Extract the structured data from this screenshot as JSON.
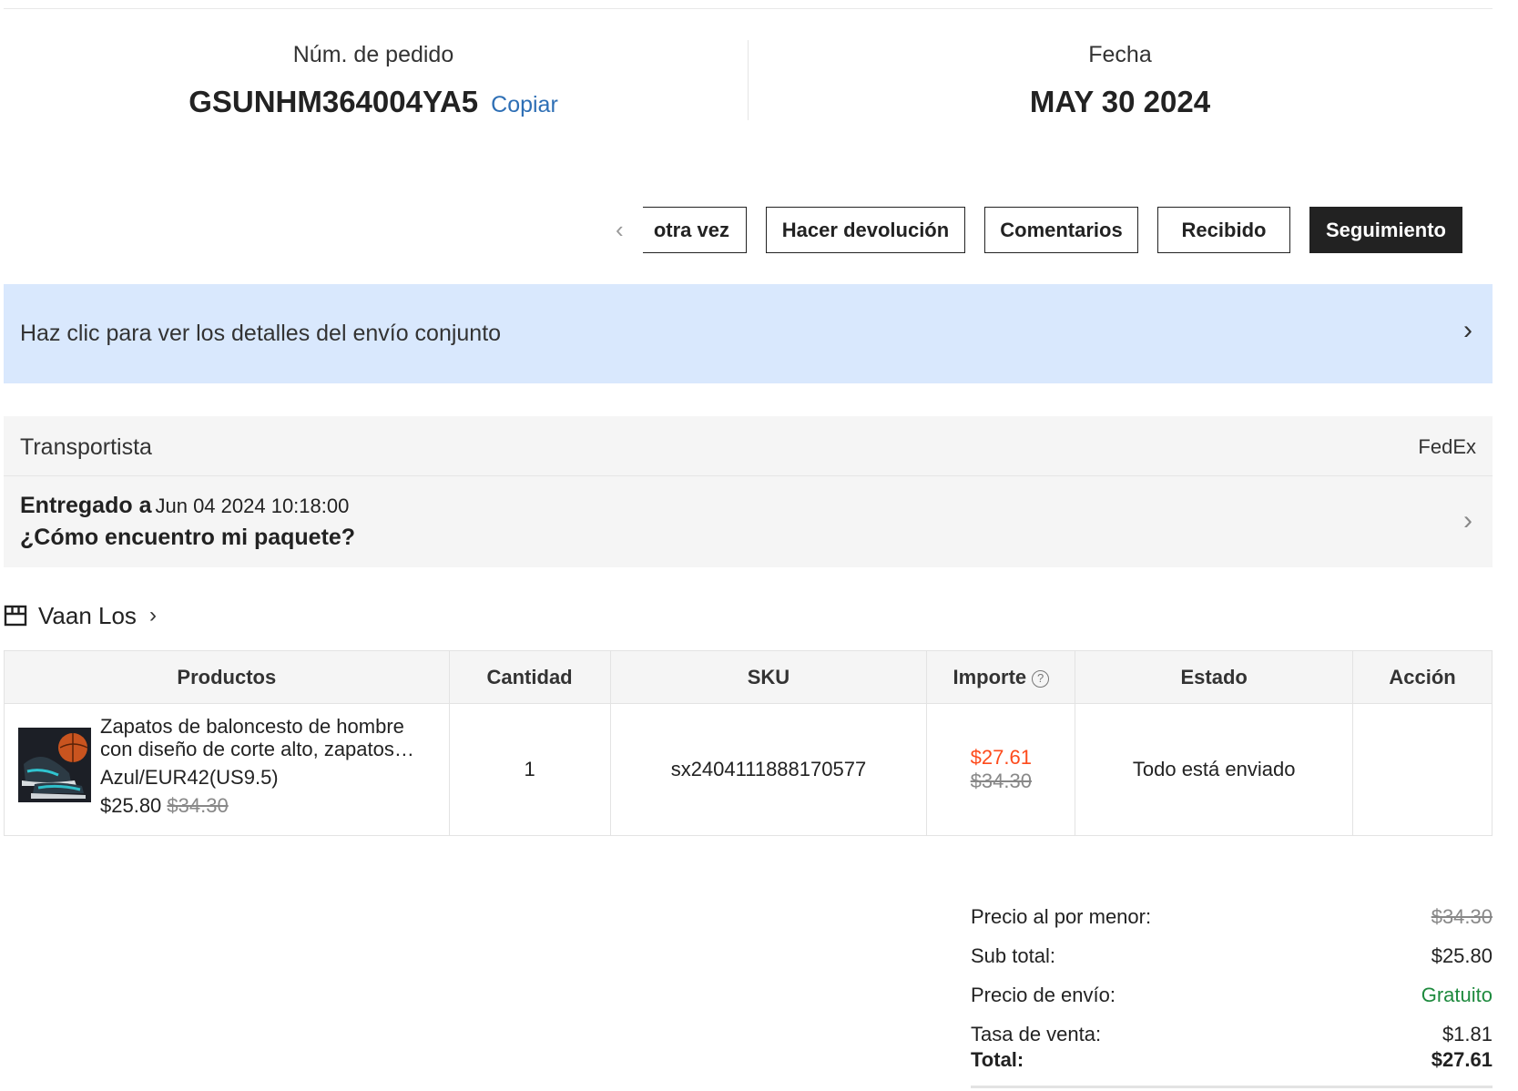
{
  "order": {
    "number_label": "Núm. de pedido",
    "number_value": "GSUNHM364004YA5",
    "copy_label": "Copiar",
    "date_label": "Fecha",
    "date_value": "MAY 30 2024"
  },
  "actions": {
    "buy_again_clipped": "otra vez",
    "return_label": "Hacer devolución",
    "comments_label": "Comentarios",
    "received_label": "Recibido",
    "tracking_label": "Seguimiento"
  },
  "banner": {
    "text": "Haz clic para ver los detalles del envío conjunto"
  },
  "shipping": {
    "carrier_label": "Transportista",
    "carrier_value": "FedEx",
    "delivered_label": "Entregado a",
    "delivered_date": "Jun 04 2024 10:18:00",
    "find_package": "¿Cómo encuentro mi paquete?"
  },
  "store": {
    "name": "Vaan Los",
    "icon": "store-icon"
  },
  "table": {
    "headers": [
      "Productos",
      "Cantidad",
      "SKU",
      "Importe",
      "Estado",
      "Acción"
    ],
    "rows": [
      {
        "name": "Zapatos de baloncesto de hombre con diseño de corte alto, zapatos…",
        "variant": "Azul/EUR42(US9.5)",
        "price": "$25.80",
        "original_price": "$34.30",
        "quantity": "1",
        "sku": "sx2404111888170577",
        "amount": "$27.61",
        "amount_original": "$34.30",
        "status": "Todo está enviado",
        "action": ""
      }
    ]
  },
  "summary": {
    "retail_label": "Precio al por menor:",
    "retail_value": "$34.30",
    "subtotal_label": "Sub total:",
    "subtotal_value": "$25.80",
    "shipping_label": "Precio de envío:",
    "shipping_value": "Gratuito",
    "tax_label": "Tasa de venta:",
    "tax_value": "$1.81",
    "total_label": "Total:",
    "total_value": "$27.61"
  },
  "colors": {
    "banner_bg": "#d9e8fd",
    "link": "#2e6fb5",
    "sale_price": "#fd4b1c",
    "free_shipping": "#1e8a3e",
    "primary_button": "#222222"
  }
}
